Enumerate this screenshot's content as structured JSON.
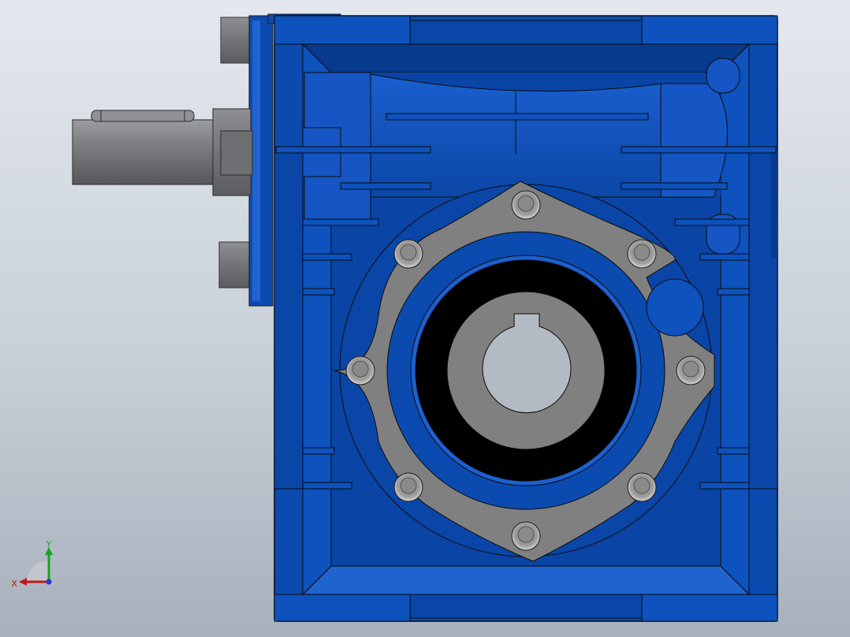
{
  "viewport": {
    "background_top": "#e4e8ee",
    "background_bottom": "#a7b0bc"
  },
  "model": {
    "type": "worm-gear-reducer",
    "view": "front",
    "colors": {
      "housing": "#0b4bb0",
      "housing_dark": "#08337e",
      "housing_light": "#1f63cf",
      "flange": "#808080",
      "shaft": "#7b7d80",
      "bore": "#000000",
      "hole": "#b3bac4"
    }
  },
  "triad": {
    "x_label": "X",
    "y_label": "Y",
    "x_color": "#c0171a",
    "y_color": "#14a520",
    "z_color": "#1f3ccf"
  }
}
